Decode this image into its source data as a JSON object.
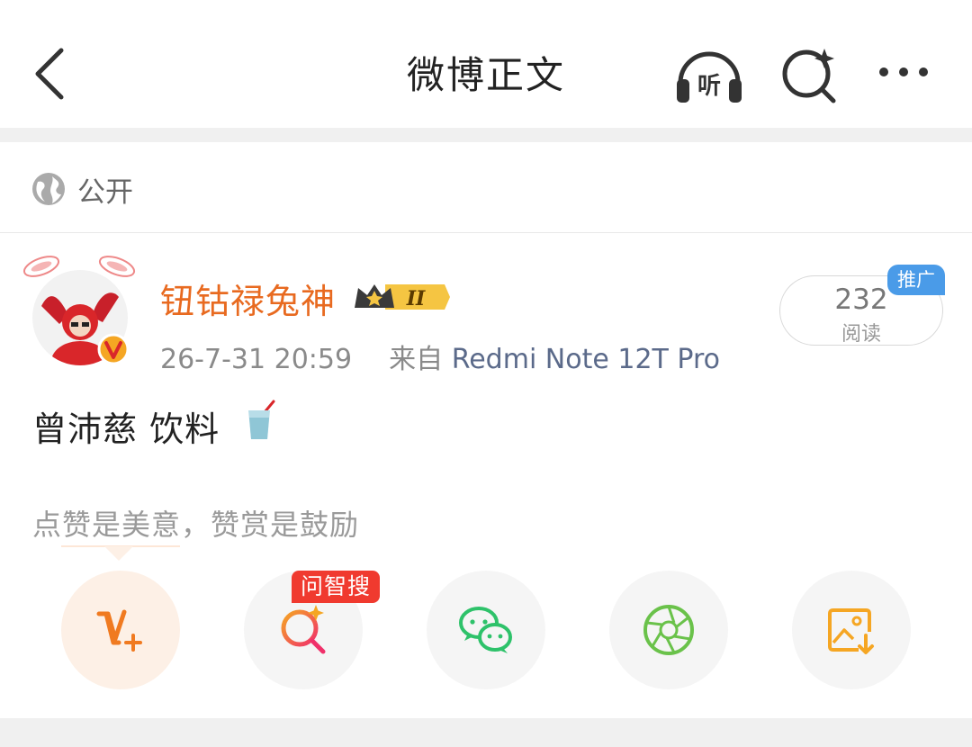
{
  "header": {
    "title": "微博正文",
    "listen_icon_text": "听"
  },
  "visibility": {
    "label": "公开"
  },
  "post": {
    "author": "钮钴禄兔神",
    "level_badge": "II",
    "timestamp": "26-7-31 20:59",
    "source_prefix": "来自",
    "device": "Redmi Note 12T Pro",
    "text": "曾沛慈 饮料",
    "emoji_icon": "cup-drink-icon",
    "reads": {
      "count": "232",
      "label": "阅读",
      "promo": "推广"
    }
  },
  "tip": "点赞是美意，赞赏是鼓励",
  "actions": [
    {
      "name": "vplus",
      "icon": "vplus-icon",
      "color": "#f07a20"
    },
    {
      "name": "ai-search",
      "icon": "ai-search-icon",
      "badge": "问智搜",
      "color": "#f03a5a"
    },
    {
      "name": "wechat",
      "icon": "wechat-icon",
      "color": "#2ec26a"
    },
    {
      "name": "moments",
      "icon": "moments-aperture-icon",
      "color": "#6ac24a"
    },
    {
      "name": "save-image",
      "icon": "save-image-icon",
      "color": "#f5a623"
    }
  ],
  "colors": {
    "username": "#e86a20",
    "promo_badge": "#4a9be8",
    "ai_badge": "#f03a2f"
  }
}
